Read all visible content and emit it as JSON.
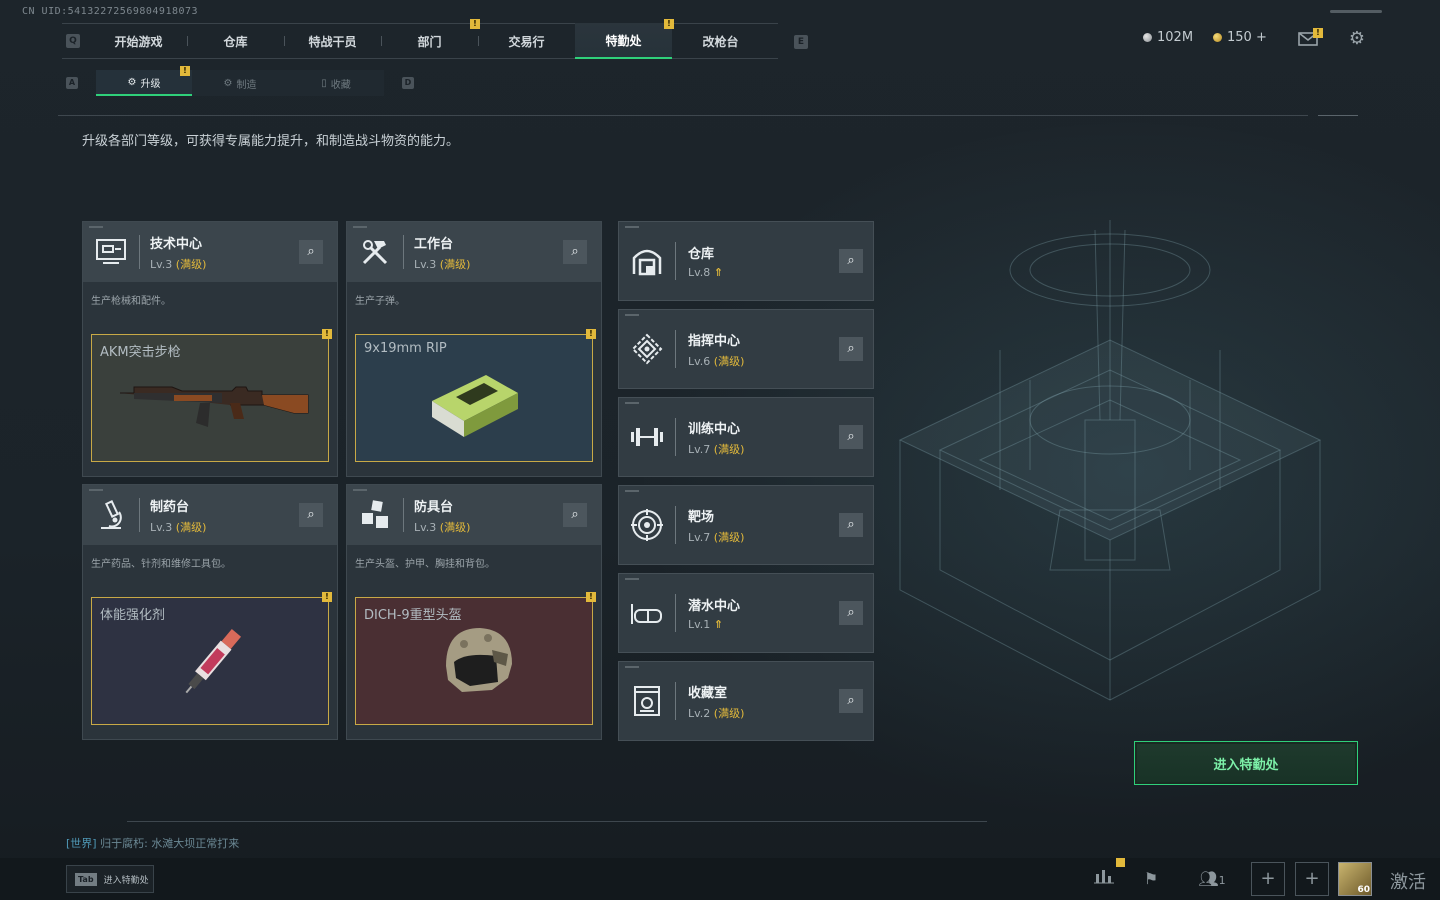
{
  "uid": "CN UID:54132272569804918073",
  "nav": {
    "key_left": "Q",
    "key_right": "E",
    "tabs": [
      {
        "label": "开始游戏",
        "active": false,
        "badge": ""
      },
      {
        "label": "仓库",
        "active": false,
        "badge": ""
      },
      {
        "label": "特战干员",
        "active": false,
        "badge": ""
      },
      {
        "label": "部门",
        "active": false,
        "badge": "!"
      },
      {
        "label": "交易行",
        "active": false,
        "badge": ""
      },
      {
        "label": "特勤处",
        "active": true,
        "badge": "!"
      },
      {
        "label": "改枪台",
        "active": false,
        "badge": ""
      }
    ]
  },
  "currency": {
    "silver": "102M",
    "gold": "150 +"
  },
  "mail_badge": "!",
  "subnav": {
    "key_left": "A",
    "key_right": "D",
    "tabs": [
      {
        "label": "升级",
        "active": true,
        "badge": "!"
      },
      {
        "label": "制造",
        "active": false,
        "badge": ""
      },
      {
        "label": "收藏",
        "active": false,
        "badge": ""
      }
    ]
  },
  "description": "升级各部门等级，可获得专属能力提升，和制造战斗物资的能力。",
  "cards": [
    {
      "title": "技术中心",
      "level": "Lv.3",
      "max": "(满级)",
      "desc": "生产枪械和配件。",
      "product": "AKM突击步枪",
      "icon": "monitor-icon",
      "badge": "!"
    },
    {
      "title": "工作台",
      "level": "Lv.3",
      "max": "(满级)",
      "desc": "生产子弹。",
      "product": "9x19mm RIP",
      "icon": "hammer-wrench-icon",
      "badge": "!"
    },
    {
      "title": "制药台",
      "level": "Lv.3",
      "max": "(满级)",
      "desc": "生产药品、针剂和维修工具包。",
      "product": "体能强化剂",
      "icon": "microscope-icon",
      "badge": "!"
    },
    {
      "title": "防具台",
      "level": "Lv.3",
      "max": "(满级)",
      "desc": "生产头盔、护甲、胸挂和背包。",
      "product": "DICH-9重型头盔",
      "icon": "cubes-icon",
      "badge": "!"
    }
  ],
  "list": [
    {
      "title": "仓库",
      "level": "Lv.8",
      "max": "",
      "upgrade": "⇑",
      "icon": "warehouse-icon"
    },
    {
      "title": "指挥中心",
      "level": "Lv.6",
      "max": "(满级)",
      "upgrade": "",
      "icon": "command-icon"
    },
    {
      "title": "训练中心",
      "level": "Lv.7",
      "max": "(满级)",
      "upgrade": "",
      "icon": "dumbbell-icon"
    },
    {
      "title": "靶场",
      "level": "Lv.7",
      "max": "(满级)",
      "upgrade": "",
      "icon": "target-icon"
    },
    {
      "title": "潜水中心",
      "level": "Lv.1",
      "max": "",
      "upgrade": "⇑",
      "icon": "diving-mask-icon"
    },
    {
      "title": "收藏室",
      "level": "Lv.2",
      "max": "(满级)",
      "upgrade": "",
      "icon": "collection-icon"
    }
  ],
  "enter_button": "进入特勤处",
  "chat": {
    "channel": "[世界]",
    "text": " 归于腐朽: 水滩大坝正常打来"
  },
  "tab_hint": {
    "key": "Tab",
    "label": "进入特勤处"
  },
  "bottom": {
    "friends_count": "1",
    "avatar_level": "60",
    "activate": "激活"
  },
  "colors": {
    "accent": "#2fd07a",
    "gold": "#e2b93b",
    "card_bg": "#2b343b"
  }
}
